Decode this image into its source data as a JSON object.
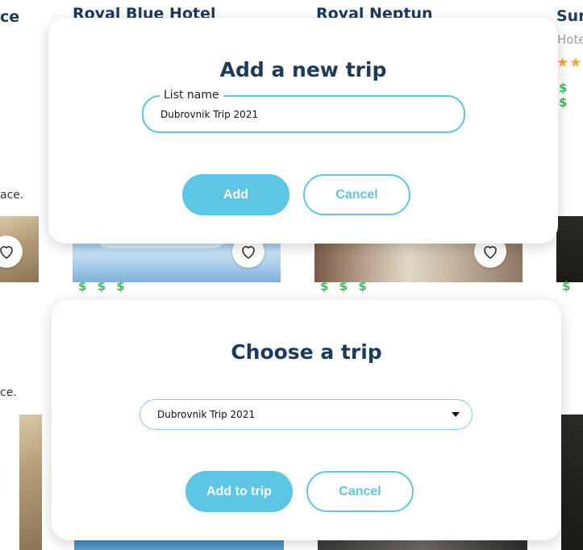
{
  "background": {
    "hotels": [
      {
        "name": "Royal Blue Hotel"
      },
      {
        "name": "Royal Neptun"
      },
      {
        "name": "Sun",
        "subtitle": "Hote"
      }
    ],
    "left_fragment_top": "ace.",
    "left_fragment_bottom": "ce.",
    "price_symbols": "$ $ $",
    "price_symbols_short": "$ $",
    "price_single": "$",
    "stars": "★★"
  },
  "add_trip_modal": {
    "title": "Add a new trip",
    "field_label": "List name",
    "field_value": "Dubrovnik Trip 2021",
    "add_label": "Add",
    "cancel_label": "Cancel"
  },
  "choose_trip_modal": {
    "title": "Choose a trip",
    "selected_trip": "Dubrovnik Trip 2021",
    "add_label": "Add to trip",
    "cancel_label": "Cancel"
  },
  "colors": {
    "accent": "#5cc6e4",
    "title": "#1b3a5c",
    "price": "#3fbf5c",
    "star": "#f4a53a"
  }
}
